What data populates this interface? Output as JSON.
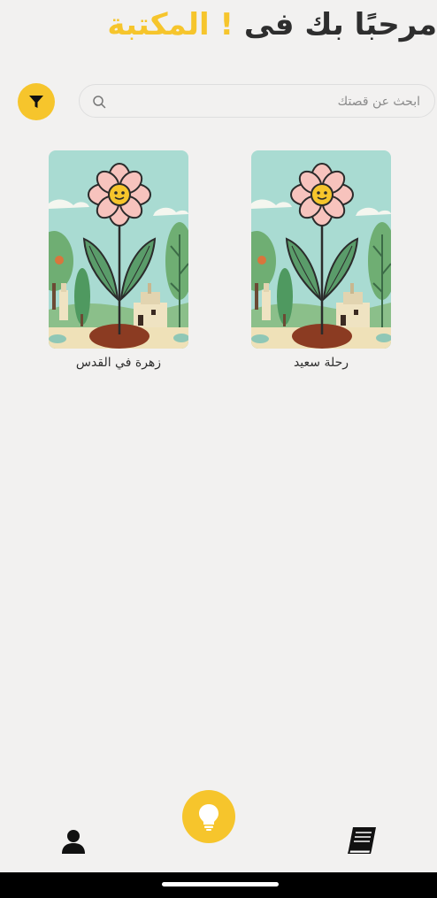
{
  "header": {
    "title_prefix": "مرحبًا بك فى ",
    "title_highlight": "! المكتبة"
  },
  "search": {
    "placeholder": "ابحث عن قصتك",
    "value": "",
    "icon": "search-icon"
  },
  "filter": {
    "icon": "filter-icon"
  },
  "stories": [
    {
      "title": "رحلة سعيد",
      "cover": "flower-illustration"
    },
    {
      "title": "زهرة في القدس",
      "cover": "flower-illustration"
    }
  ],
  "bottom_nav": {
    "items": [
      {
        "icon": "user-icon"
      },
      {
        "icon": "lightbulb-icon"
      },
      {
        "icon": "books-icon"
      }
    ]
  },
  "colors": {
    "accent": "#f6c52c",
    "background": "#f2f1f0",
    "text": "#2e2e2e"
  }
}
